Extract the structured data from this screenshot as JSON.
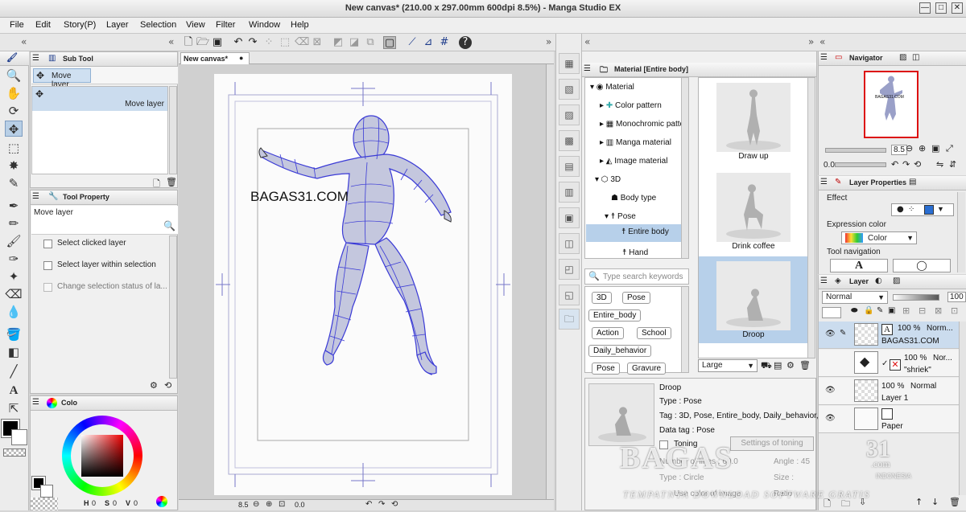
{
  "window": {
    "title": "New canvas* (210.00 x 297.00mm 600dpi 8.5%) - Manga Studio EX",
    "minimize": "—",
    "maximize": "□",
    "close": "✕"
  },
  "menu": [
    "File",
    "Edit",
    "Story(P)",
    "Layer",
    "Selection",
    "View",
    "Filter",
    "Window",
    "Help"
  ],
  "colors": {
    "accent": "#b8cfe6",
    "selection": "#cbdcee",
    "mesh": "#3b3bd6",
    "panel": "#f0f0f0"
  },
  "subtool": {
    "tab": "Sub Tool",
    "group": "Move layer",
    "item": "Move layer"
  },
  "toolproperty": {
    "tab": "Tool Property",
    "name": "Move layer",
    "options": [
      "Select clicked layer",
      "Select layer within selection",
      "Change selection status of la..."
    ]
  },
  "color_panel": {
    "tab": "Colo",
    "values": [
      "0",
      "0",
      "0"
    ]
  },
  "canvas": {
    "tab": "New canvas*",
    "watermark_text": "BAGAS31.COM",
    "zoom": "8.5",
    "rotation": "0.0"
  },
  "material": {
    "tab": "Material [Entire body]",
    "tree": [
      {
        "label": "Material",
        "indent": 0
      },
      {
        "label": "Color pattern",
        "indent": 1
      },
      {
        "label": "Monochromic patte",
        "indent": 1
      },
      {
        "label": "Manga material",
        "indent": 1
      },
      {
        "label": "Image material",
        "indent": 1
      },
      {
        "label": "3D",
        "indent": 1
      },
      {
        "label": "Body type",
        "indent": 2
      },
      {
        "label": "Pose",
        "indent": 2
      },
      {
        "label": "Entire body",
        "indent": 3
      },
      {
        "label": "Hand",
        "indent": 3
      }
    ],
    "search_placeholder": "Type search keywords",
    "tags": [
      "3D",
      "Pose",
      "Entire_body",
      "Action",
      "School",
      "Daily_behavior",
      "Pose",
      "Gravure"
    ],
    "thumbnails": [
      "Draw up",
      "Drink coffee",
      "Droop"
    ],
    "size_option": "Large",
    "detail": {
      "name": "Droop",
      "type": "Type : Pose",
      "tag": "Tag : 3D, Pose, Entire_body, Daily_behavior,",
      "datatag": "Data tag : Pose",
      "toning": "Toning",
      "toning_settings": "Settings of toning",
      "lines": "Number of lines : 60.0",
      "angle": "Angle : 45",
      "shape": "Type : Circle",
      "size": "Size :",
      "usecolor": "Use color of image",
      "ratio": "Ratio"
    }
  },
  "navigator": {
    "tab": "Navigator",
    "zoom": "8.5",
    "rotation": "0.0"
  },
  "layer_properties": {
    "tab": "Layer Properties",
    "effect": "Effect",
    "expression": "Expression color",
    "color_option": "Color",
    "tool_nav": "Tool navigation"
  },
  "layers": {
    "tab": "Layer",
    "blend": "Normal",
    "opacity": "100",
    "items": [
      {
        "pct": "100 %",
        "mode": "Norm...",
        "name": "BAGAS31.COM"
      },
      {
        "pct": "100 %",
        "mode": "Nor...",
        "name": "\"shriek\""
      },
      {
        "pct": "100 %",
        "mode": "Normal",
        "name": "Layer 1"
      },
      {
        "pct": "",
        "mode": "",
        "name": "Paper"
      }
    ]
  },
  "site_watermark": {
    "brand": "BAGAS",
    "number": "31",
    "domain": ".com",
    "country": "INDONESIA",
    "tagline": "TEMPATNYA DOWNLOAD SOFTWARE GRATIS"
  }
}
